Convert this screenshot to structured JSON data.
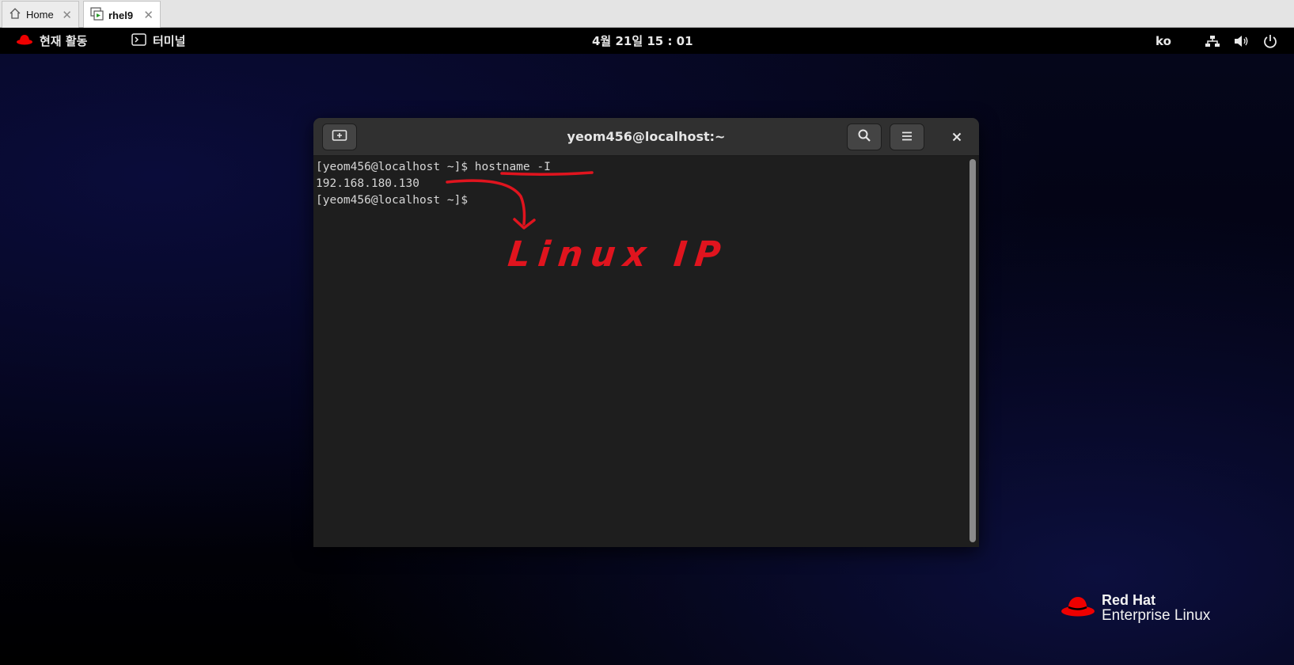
{
  "vmware_tabs": [
    {
      "label": "Home",
      "icon": "home-icon"
    },
    {
      "label": "rhel9",
      "icon": "vm-icon"
    }
  ],
  "topbar": {
    "activities_label": "현재 활동",
    "app_label": "터미널",
    "clock": "4월 21일 15 : 01",
    "input_method": "ko"
  },
  "terminal": {
    "title": "yeom456@localhost:~",
    "lines": [
      {
        "prompt": "[yeom456@localhost ~]$ ",
        "command": "hostname -I"
      },
      {
        "output": "192.168.180.130"
      },
      {
        "prompt": "[yeom456@localhost ~]$ ",
        "command": ""
      }
    ]
  },
  "annotation": {
    "text": "Linux IP",
    "color": "#e0141e"
  },
  "branding": {
    "line1": "Red Hat",
    "line2": "Enterprise Linux",
    "color": "#ee0000"
  }
}
